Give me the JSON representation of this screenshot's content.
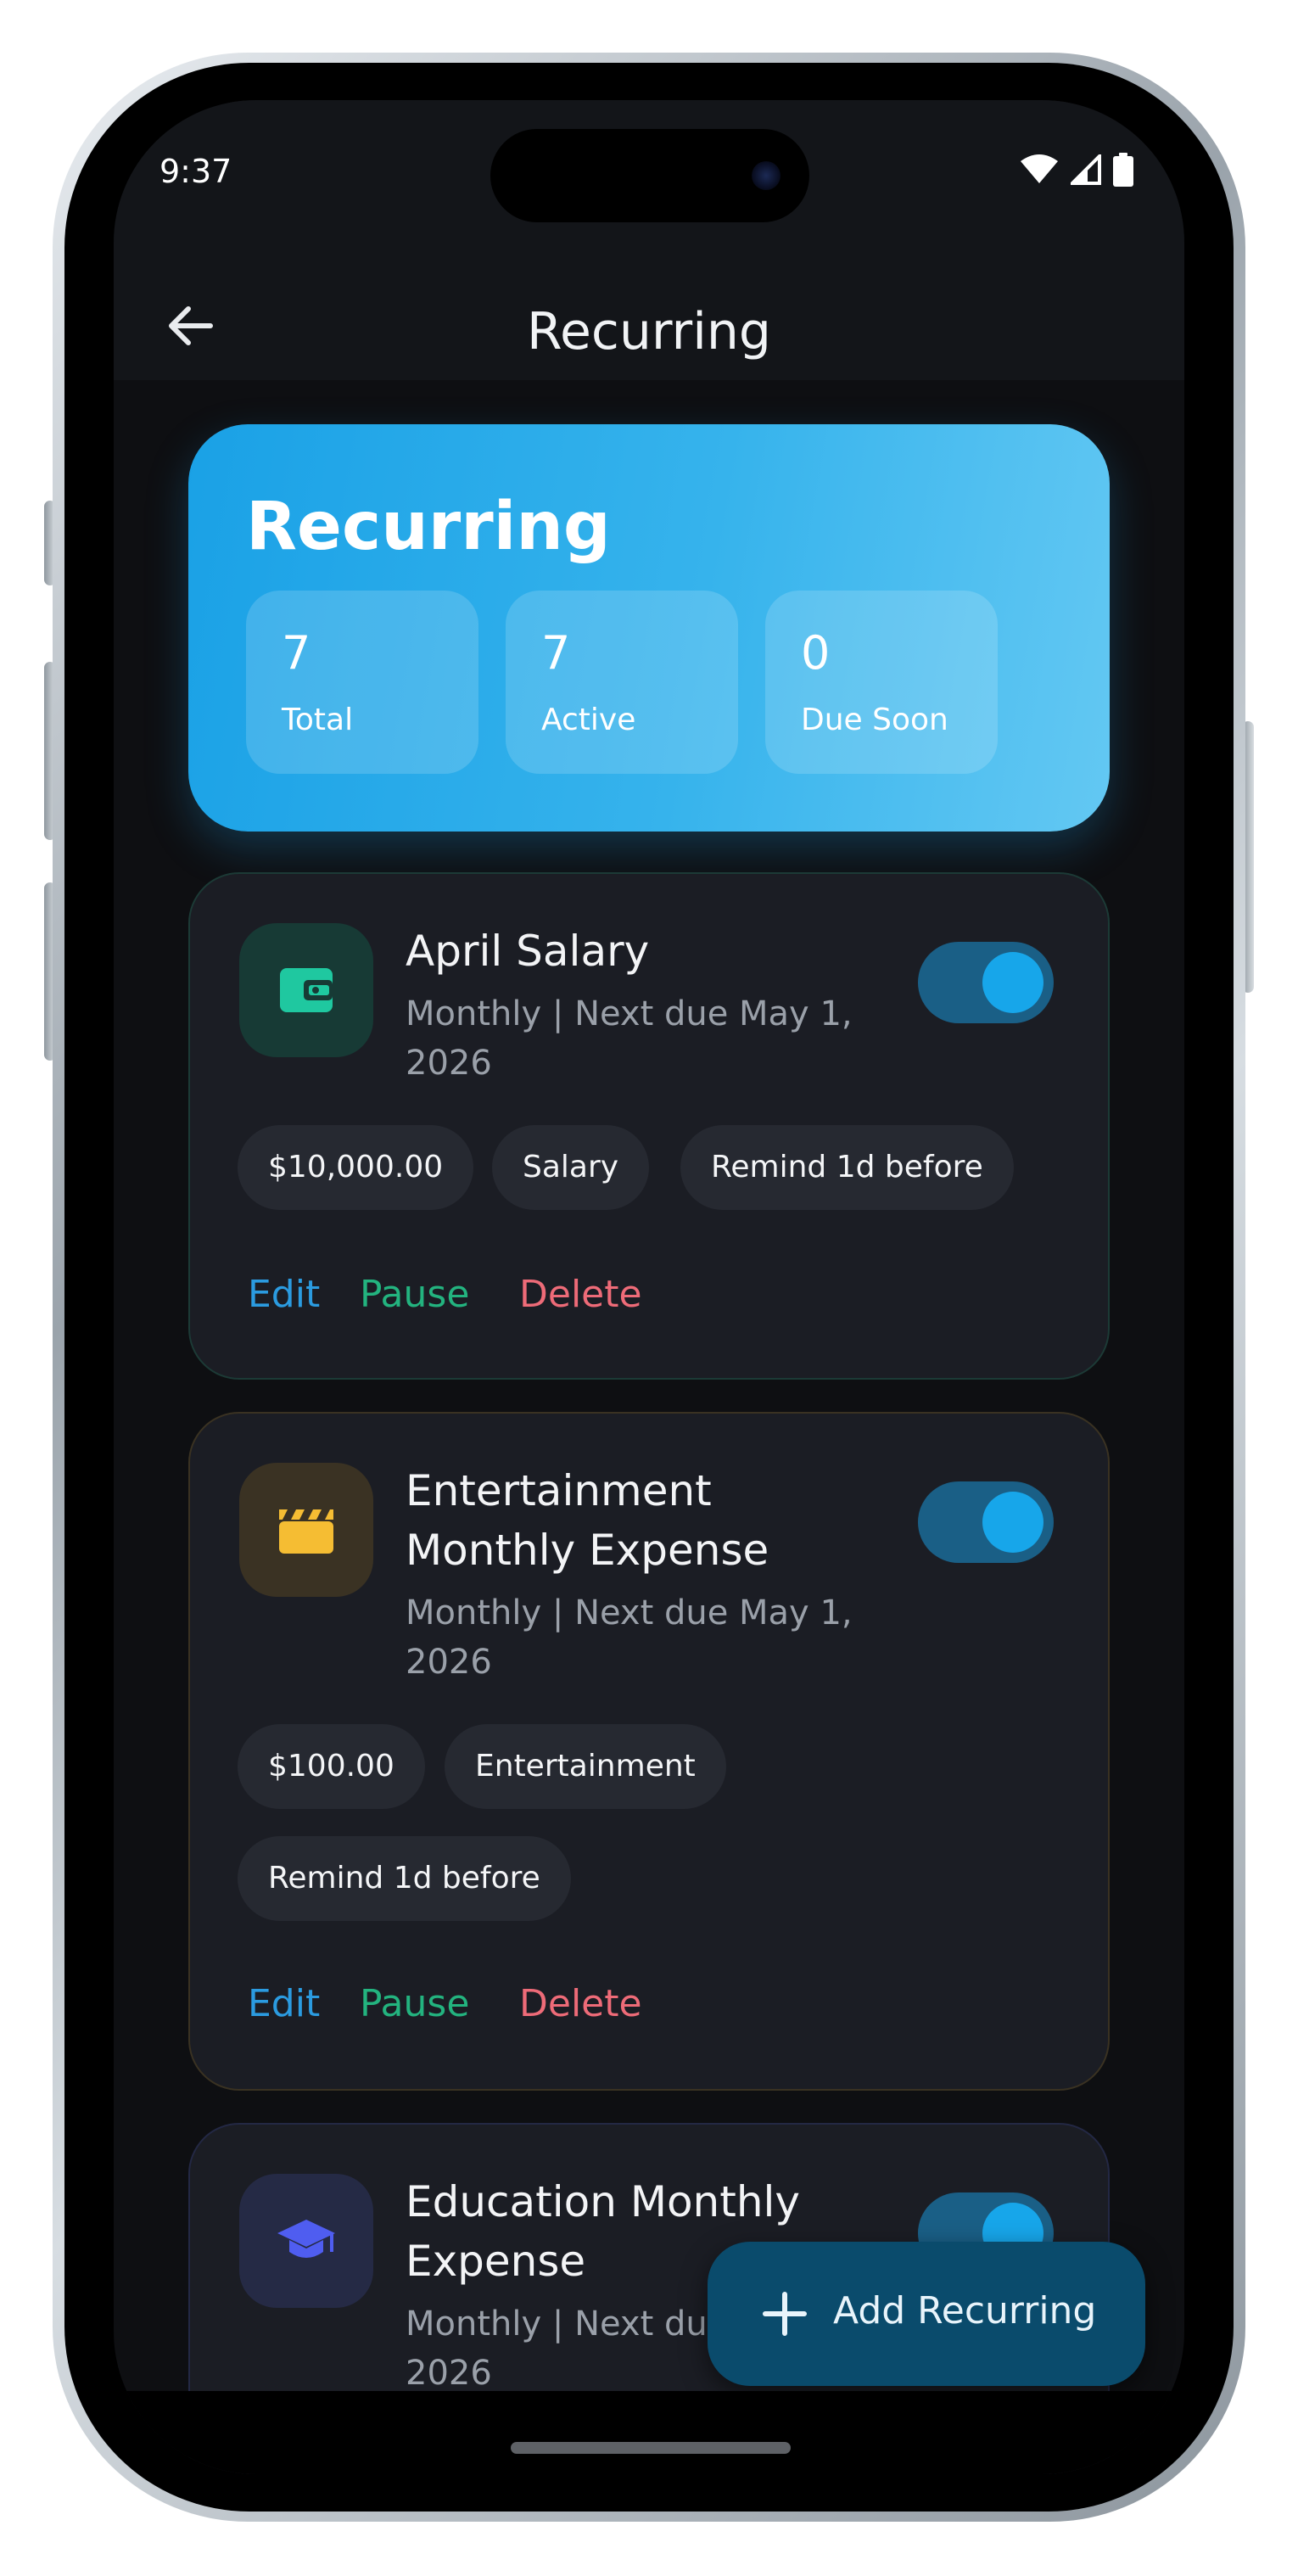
{
  "status_bar": {
    "time": "9:37"
  },
  "app_bar": {
    "title": "Recurring"
  },
  "summary": {
    "title": "Recurring",
    "stats": [
      {
        "value": "7",
        "label": "Total"
      },
      {
        "value": "7",
        "label": "Active"
      },
      {
        "value": "0",
        "label": "Due Soon"
      }
    ]
  },
  "items": [
    {
      "title": "April Salary",
      "subtitle": "Monthly | Next due May 1, 2026",
      "icon": "wallet-icon",
      "active": true,
      "chips": [
        "$10,000.00",
        "Salary",
        "Remind 1d before"
      ],
      "actions": {
        "edit": "Edit",
        "pause": "Pause",
        "delete": "Delete"
      }
    },
    {
      "title": "Entertainment Monthly Expense",
      "subtitle": "Monthly | Next due May 1, 2026",
      "icon": "clapperboard-icon",
      "active": true,
      "chips": [
        "$100.00",
        "Entertainment",
        "Remind 1d before"
      ],
      "actions": {
        "edit": "Edit",
        "pause": "Pause",
        "delete": "Delete"
      }
    },
    {
      "title": "Education Monthly Expense",
      "subtitle": "Monthly | Next due",
      "subtitle_line2": "2026",
      "icon": "graduation-cap-icon",
      "active": true
    }
  ],
  "fab": {
    "label": "Add Recurring",
    "icon": "plus-icon"
  },
  "colors": {
    "accent": "#17a6ea",
    "card_bg": "#1b1d24",
    "edit": "#2b9be0",
    "pause": "#23b37f",
    "delete": "#ee6b78",
    "salary_icon": "#1fc8a0",
    "entertainment_icon": "#f5bd33",
    "education_icon": "#4f5df0"
  }
}
